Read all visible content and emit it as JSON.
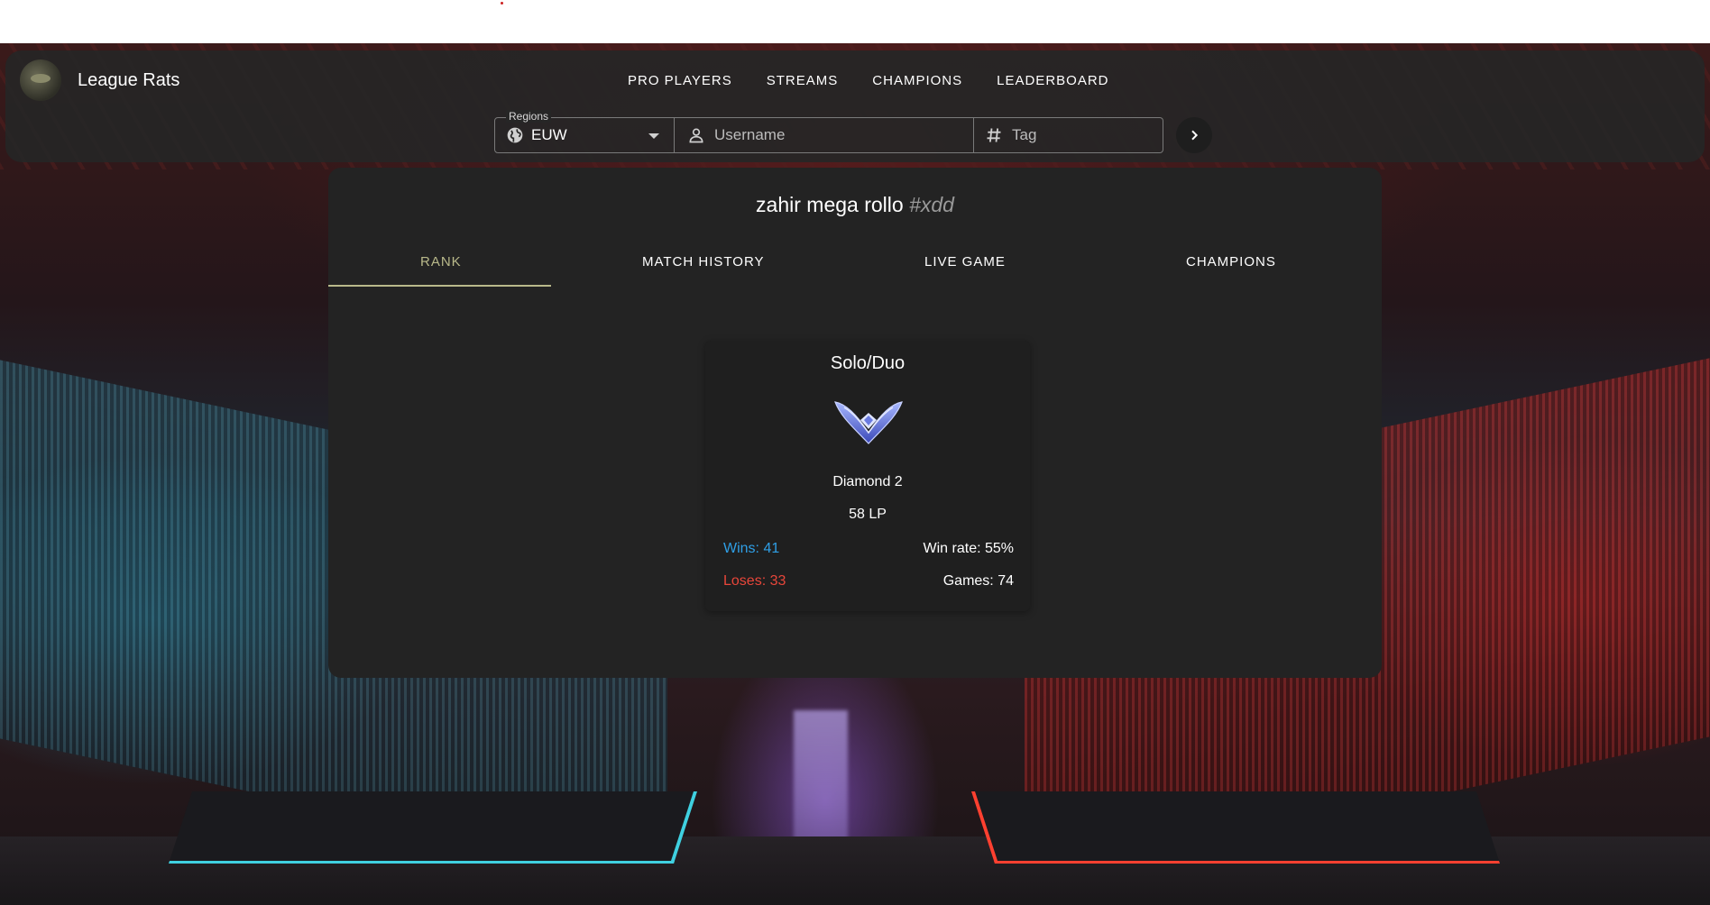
{
  "app": {
    "name": "League Rats"
  },
  "nav": {
    "items": [
      {
        "label": "PRO PLAYERS"
      },
      {
        "label": "STREAMS"
      },
      {
        "label": "CHAMPIONS"
      },
      {
        "label": "LEADERBOARD"
      }
    ]
  },
  "search": {
    "region_label": "Regions",
    "region_value": "EUW",
    "username_placeholder": "Username",
    "tag_placeholder": "Tag"
  },
  "player": {
    "name": "zahir mega rollo",
    "tag": "#xdd"
  },
  "tabs": [
    {
      "label": "RANK",
      "active": true
    },
    {
      "label": "MATCH HISTORY",
      "active": false
    },
    {
      "label": "LIVE GAME",
      "active": false
    },
    {
      "label": "CHAMPIONS",
      "active": false
    }
  ],
  "rank_card": {
    "queue": "Solo/Duo",
    "emblem": "diamond-emblem-icon",
    "tier": "Diamond 2",
    "lp": "58 LP",
    "wins": "Wins: 41",
    "win_rate": "Win rate: 55%",
    "loses": "Loses: 33",
    "games": "Games: 74"
  },
  "colors": {
    "accent": "#b9b98a",
    "wins": "#2f9fe6",
    "loses": "#e8463a",
    "panel": "#232323"
  }
}
